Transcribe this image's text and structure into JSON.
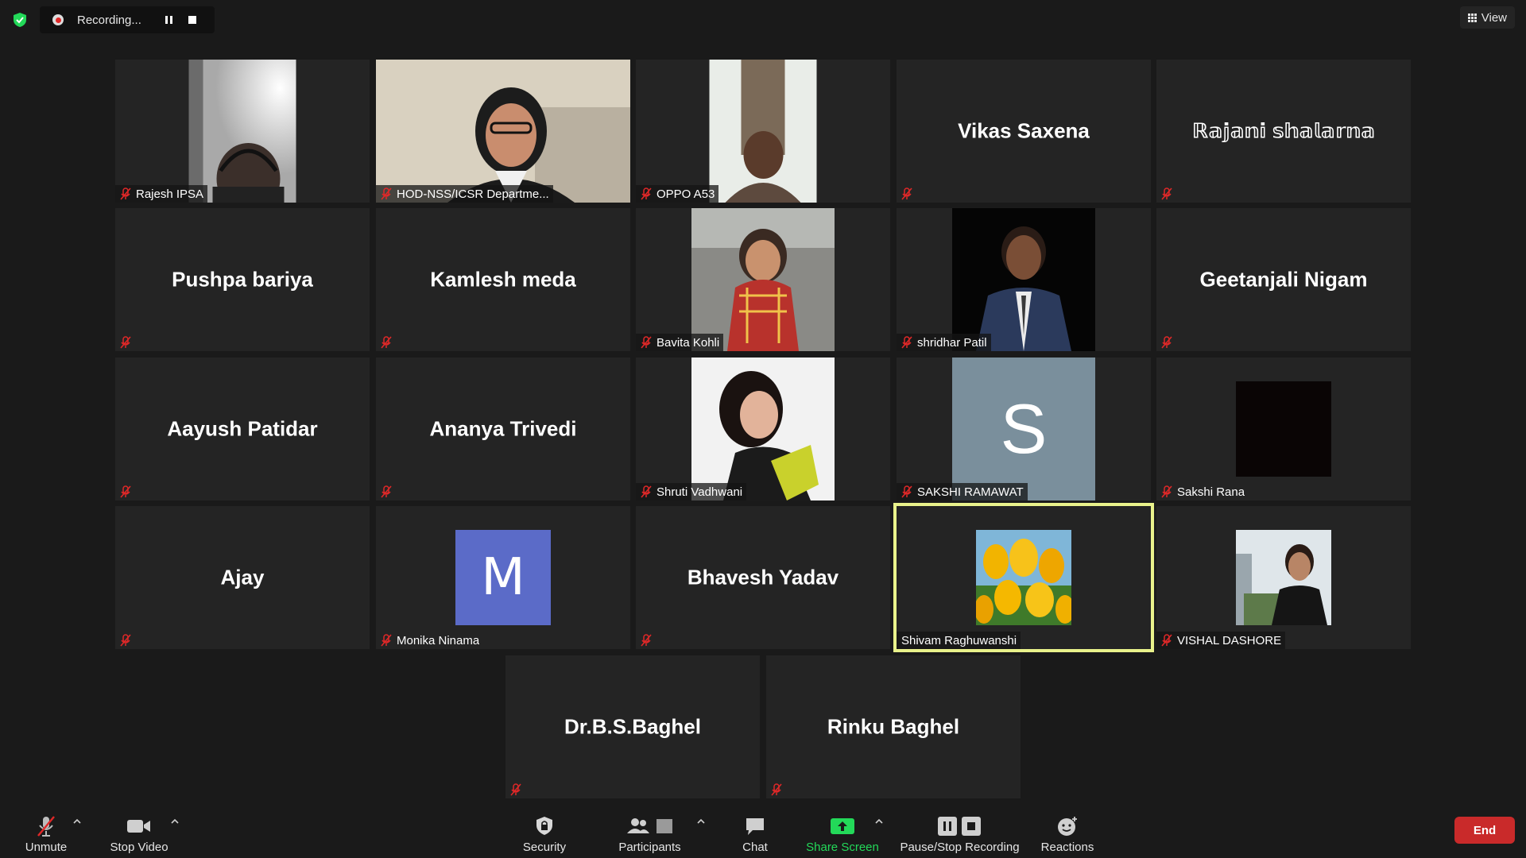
{
  "top_bar": {
    "recording_status": "Recording...",
    "view_label": "View"
  },
  "participants": [
    {
      "name": "Rajesh IPSA",
      "display": "video",
      "muted": true
    },
    {
      "name": "HOD-NSS/ICSR Departme...",
      "display": "video",
      "muted": true
    },
    {
      "name": "OPPO A53",
      "display": "video",
      "muted": true
    },
    {
      "name": "Vikas Saxena",
      "display": "name",
      "muted": true
    },
    {
      "name": "ℝ𝕒𝕛𝕒𝕟𝕚 𝕤𝕙𝕒𝕝𝕒𝕣𝕟𝕒",
      "display": "name",
      "muted": true
    },
    {
      "name": "Pushpa bariya",
      "display": "name",
      "muted": true
    },
    {
      "name": "Kamlesh meda",
      "display": "name",
      "muted": true
    },
    {
      "name": "Bavita Kohli",
      "display": "video",
      "muted": true
    },
    {
      "name": "shridhar Patil",
      "display": "video",
      "muted": true
    },
    {
      "name": "Geetanjali Nigam",
      "display": "name",
      "muted": true
    },
    {
      "name": "Aayush Patidar",
      "display": "name",
      "muted": true
    },
    {
      "name": "Ananya Trivedi",
      "display": "name",
      "muted": true
    },
    {
      "name": "Shruti Vadhwani",
      "display": "video",
      "muted": true
    },
    {
      "name": "SAKSHI RAMAWAT",
      "display": "avatar",
      "initial": "S",
      "muted": true
    },
    {
      "name": "Sakshi Rana",
      "display": "avatar",
      "muted": true
    },
    {
      "name": "Ajay",
      "display": "name",
      "muted": true
    },
    {
      "name": "Monika Ninama",
      "display": "avatar",
      "initial": "M",
      "muted": true
    },
    {
      "name": "Bhavesh Yadav",
      "display": "name",
      "muted": true
    },
    {
      "name": "Shivam Raghuwanshi",
      "display": "avatar",
      "muted": false,
      "active_speaker": true
    },
    {
      "name": "VISHAL DASHORE",
      "display": "avatar",
      "muted": true
    },
    {
      "name": "Dr.B.S.Baghel",
      "display": "name",
      "muted": true
    },
    {
      "name": "Rinku Baghel",
      "display": "name",
      "muted": true
    }
  ],
  "toolbar": {
    "unmute": "Unmute",
    "stop_video": "Stop Video",
    "security": "Security",
    "participants": "Participants",
    "chat": "Chat",
    "share_screen": "Share Screen",
    "recording": "Pause/Stop Recording",
    "reactions": "Reactions",
    "end": "End"
  },
  "colors": {
    "background": "#1a1a1a",
    "tile": "#242424",
    "active_speaker_border": "#e9f28b",
    "mute_red": "#e02828",
    "share_green": "#23d959",
    "end_red": "#c92a2a",
    "avatar_s_bg": "#7a8f9c",
    "avatar_m_bg": "#5b6bc8"
  }
}
